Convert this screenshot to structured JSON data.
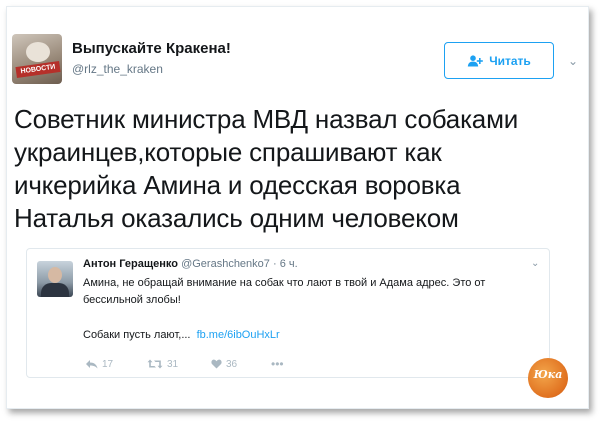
{
  "author": {
    "display_name": "Выпускайте Кракена!",
    "handle": "@rlz_the_kraken",
    "avatar_banner": "НОВОСТИ"
  },
  "follow_button": {
    "label": "Читать",
    "icon": "add-user-icon"
  },
  "tweet": {
    "text_lines": [
      "Советник министра МВД назвал собаками",
      "украинцев,которые спрашивают как",
      "ичкерийка Амина и одесская воровка",
      "Наталья оказались одним человеком"
    ]
  },
  "quoted": {
    "name": "Антон Геращенко",
    "handle": "@Gerashchenko7",
    "separator": "·",
    "time": "6 ч.",
    "body": "Амина, не обращай внимание на собак что лают в твой и Адама адрес. Это от бессильной злобы!",
    "body2": "Собаки пусть лают,...",
    "link": "fb.me/6ibOuHxLr",
    "actions": {
      "reply_count": "17",
      "retweet_count": "31",
      "like_count": "36"
    }
  },
  "watermark": {
    "text": "Юка"
  },
  "colors": {
    "accent": "#1da1f2",
    "muted": "#657786",
    "text": "#14171a"
  }
}
